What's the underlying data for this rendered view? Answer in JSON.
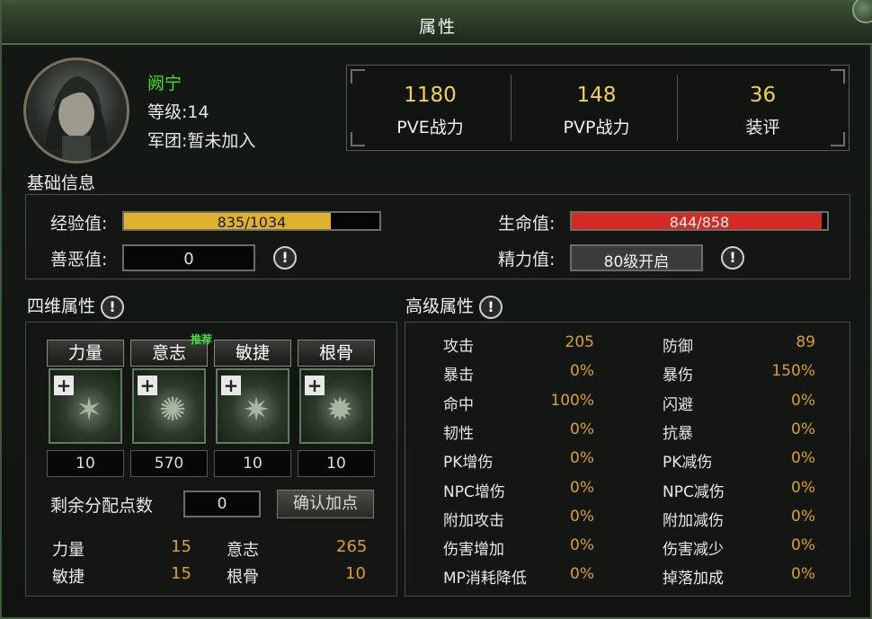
{
  "window": {
    "title": "属性"
  },
  "character": {
    "name": "阙宁",
    "level": "等级:14",
    "guild": "军团:暂未加入"
  },
  "power": [
    {
      "value": "1180",
      "label": "PVE战力"
    },
    {
      "value": "148",
      "label": "PVP战力"
    },
    {
      "value": "36",
      "label": "装评"
    }
  ],
  "basic": {
    "title": "基础信息",
    "exp": {
      "label": "经验值:",
      "text": "835/1034",
      "fraction": 0.81,
      "color": "#e0b12c"
    },
    "hp": {
      "label": "生命值:",
      "text": "844/858",
      "fraction": 0.98,
      "color": "#d52a24"
    },
    "karma": {
      "label": "善恶值:",
      "value": "0"
    },
    "energy": {
      "label": "精力值:",
      "value": "80级开启"
    }
  },
  "four_attr": {
    "title": "四维属性",
    "recommend_badge": "推荐",
    "attrs": [
      {
        "name": "力量",
        "value": "10"
      },
      {
        "name": "意志",
        "value": "570"
      },
      {
        "name": "敏捷",
        "value": "10"
      },
      {
        "name": "根骨",
        "value": "10"
      }
    ],
    "remaining_label": "剩余分配点数",
    "remaining_value": "0",
    "confirm_button": "确认加点",
    "summary": [
      {
        "name": "力量",
        "value": "15"
      },
      {
        "name": "意志",
        "value": "265"
      },
      {
        "name": "敏捷",
        "value": "15"
      },
      {
        "name": "根骨",
        "value": "10"
      }
    ]
  },
  "advanced": {
    "title": "高级属性",
    "rows": [
      {
        "l_name": "攻击",
        "l_val": "205",
        "r_name": "防御",
        "r_val": "89"
      },
      {
        "l_name": "暴击",
        "l_val": "0%",
        "r_name": "暴伤",
        "r_val": "150%"
      },
      {
        "l_name": "命中",
        "l_val": "100%",
        "r_name": "闪避",
        "r_val": "0%"
      },
      {
        "l_name": "韧性",
        "l_val": "0%",
        "r_name": "抗暴",
        "r_val": "0%"
      },
      {
        "l_name": "PK增伤",
        "l_val": "0%",
        "r_name": "PK减伤",
        "r_val": "0%"
      },
      {
        "l_name": "NPC增伤",
        "l_val": "0%",
        "r_name": "NPC减伤",
        "r_val": "0%"
      },
      {
        "l_name": "附加攻击",
        "l_val": "0%",
        "r_name": "附加减伤",
        "r_val": "0%"
      },
      {
        "l_name": "伤害增加",
        "l_val": "0%",
        "r_name": "伤害减少",
        "r_val": "0%"
      },
      {
        "l_name": "MP消耗降低",
        "l_val": "0%",
        "r_name": "掉落加成",
        "r_val": "0%"
      }
    ]
  },
  "colors": {
    "name": "#4cdc2a",
    "value_gold": "#d9a227",
    "power_value": "#f2d24a",
    "recommend": "#3fe03a"
  },
  "icons": {
    "info": "exclamation-circle-icon",
    "add": "plus-icon",
    "close": "close-icon"
  }
}
